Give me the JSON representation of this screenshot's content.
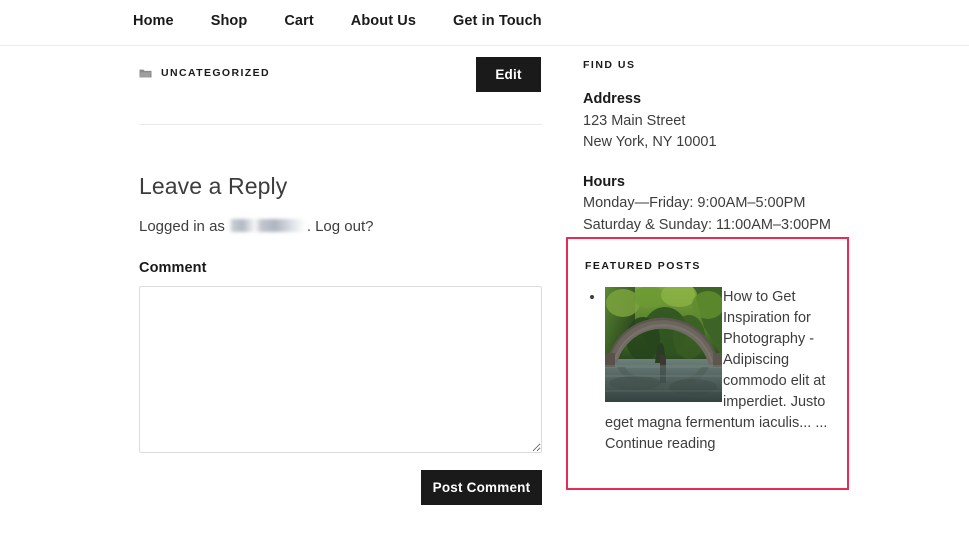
{
  "nav": {
    "items": [
      {
        "label": "Home"
      },
      {
        "label": "Shop"
      },
      {
        "label": "Cart"
      },
      {
        "label": "About Us"
      },
      {
        "label": "Get in Touch"
      }
    ]
  },
  "post_footer": {
    "category_icon": "folder-icon",
    "category": "Uncategorized",
    "edit_label": "Edit"
  },
  "comments": {
    "reply_title": "Leave a Reply",
    "logged_in_prefix": "Logged in as",
    "logged_in_user": "",
    "logged_in_separator": ".",
    "logout_label": "Log out?",
    "comment_label": "Comment",
    "comment_value": "",
    "comment_placeholder": "",
    "submit_label": "Post Comment"
  },
  "sidebar": {
    "find_us": {
      "title": "Find Us",
      "address_heading": "Address",
      "address_line1": "123 Main Street",
      "address_line2": "New York, NY 10001",
      "hours_heading": "Hours",
      "hours_line1": "Monday—Friday: 9:00AM–5:00PM",
      "hours_line2": "Saturday & Sunday: 11:00AM–3:00PM"
    },
    "featured_posts": {
      "title": "Featured Posts",
      "highlight_color": "#e82b54",
      "items": [
        {
          "thumbnail_alt": "stone-arch-bridge-over-lake",
          "excerpt": "How to Get Inspiration for Photography - Adipiscing commodo elit at imperdiet. Justo eget magna fermentum iaculis... ...",
          "continue_label": "Continue reading"
        }
      ]
    }
  }
}
